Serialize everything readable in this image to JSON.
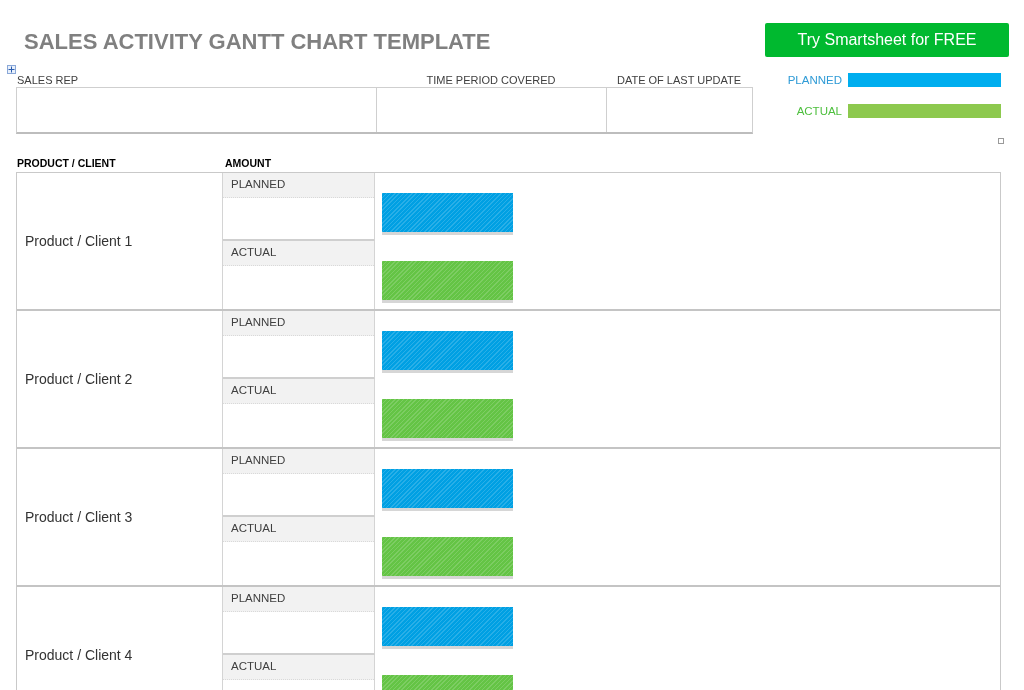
{
  "title": "SALES ACTIVITY GANTT CHART TEMPLATE",
  "cta_button": "Try Smartsheet for FREE",
  "details": {
    "fields": [
      "SALES REP",
      "TIME PERIOD COVERED",
      "DATE OF LAST UPDATE"
    ]
  },
  "legend": [
    {
      "kind": "planned",
      "label": "PLANNED",
      "color": "#00aeef"
    },
    {
      "kind": "actual",
      "label": "ACTUAL",
      "color": "#8dc94e"
    }
  ],
  "table": {
    "columns": [
      "PRODUCT / CLIENT",
      "AMOUNT"
    ],
    "rows": [
      {
        "name": "Product / Client 1",
        "amounts": [
          {
            "kind": "planned",
            "label": "PLANNED"
          },
          {
            "kind": "actual",
            "label": "ACTUAL"
          }
        ]
      },
      {
        "name": "Product / Client 2",
        "amounts": [
          {
            "kind": "planned",
            "label": "PLANNED"
          },
          {
            "kind": "actual",
            "label": "ACTUAL"
          }
        ]
      },
      {
        "name": "Product / Client 3",
        "amounts": [
          {
            "kind": "planned",
            "label": "PLANNED"
          },
          {
            "kind": "actual",
            "label": "ACTUAL"
          }
        ]
      },
      {
        "name": "Product / Client 4",
        "amounts": [
          {
            "kind": "planned",
            "label": "PLANNED"
          },
          {
            "kind": "actual",
            "label": "ACTUAL"
          }
        ]
      }
    ]
  }
}
